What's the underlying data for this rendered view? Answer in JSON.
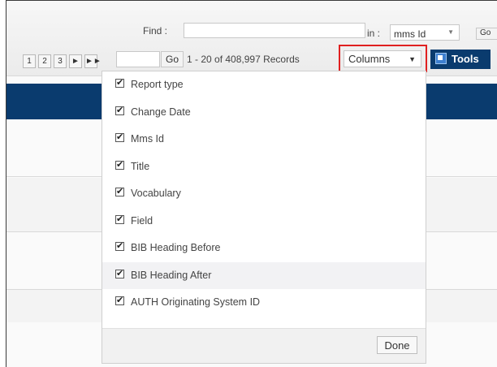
{
  "toolbar": {
    "find_label": "Find :",
    "find_value": "",
    "in_label": "in :",
    "in_value": "mms Id",
    "go_small": "Go",
    "pages": [
      "1",
      "2",
      "3",
      "►",
      "►►"
    ],
    "page_input_value": "",
    "go_label": "Go",
    "records_text": "1 - 20 of 408,997 Records",
    "columns_label": "Columns",
    "tools_label": "Tools"
  },
  "columns_menu": {
    "items": [
      {
        "label": "Report type",
        "checked": "✔"
      },
      {
        "label": "Change Date",
        "checked": "✔"
      },
      {
        "label": "Mms Id",
        "checked": "✔"
      },
      {
        "label": "Title",
        "checked": "✔"
      },
      {
        "label": "Vocabulary",
        "checked": "✔"
      },
      {
        "label": "Field",
        "checked": "✔"
      },
      {
        "label": "BIB Heading Before",
        "checked": "✔"
      },
      {
        "label": "BIB Heading After",
        "checked": "✔"
      },
      {
        "label": "AUTH Originating System ID",
        "checked": "✔"
      }
    ],
    "done_label": "Done"
  },
  "colors": {
    "accent_navy": "#0a3b6e",
    "highlight_red": "#e02020"
  },
  "icons": {
    "tools": "tools-icon",
    "dropdown": "chevron-down-icon",
    "checkbox": "checkbox-checked-icon"
  }
}
